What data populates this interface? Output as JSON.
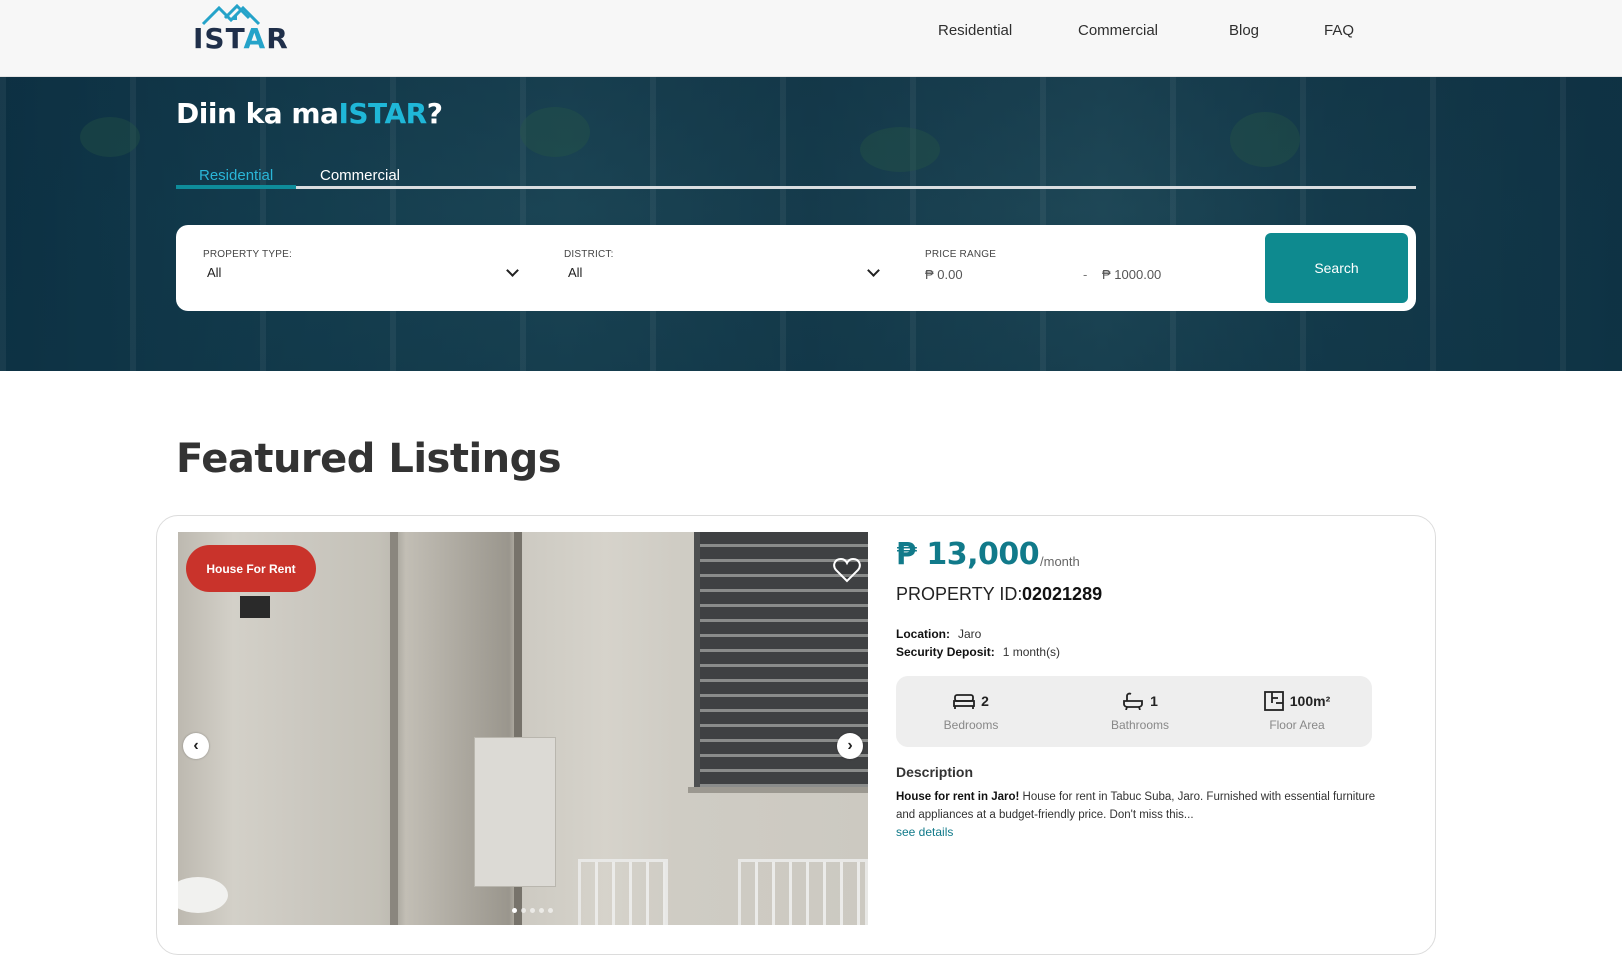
{
  "nav": {
    "logo_text_pre": "IST",
    "logo_text_a": "A",
    "logo_text_post": "R",
    "links": [
      {
        "label": "Residential"
      },
      {
        "label": "Commercial"
      },
      {
        "label": "Blog"
      },
      {
        "label": "FAQ"
      }
    ]
  },
  "hero": {
    "title_pre": "Diin ka ma",
    "title_accent": "ISTAR",
    "title_post": "?",
    "tabs": [
      {
        "label": "Residential",
        "active": true
      },
      {
        "label": "Commercial",
        "active": false
      }
    ],
    "search": {
      "property_type_label": "PROPERTY TYPE:",
      "property_type_value": "All",
      "district_label": "DISTRICT:",
      "district_value": "All",
      "price_range_label": "PRICE RANGE",
      "price_min": "₱ 0.00",
      "price_separator": "-",
      "price_max": "₱ 1000.00",
      "button_label": "Search"
    }
  },
  "featured": {
    "title": "Featured Listings",
    "listing": {
      "badge": "House For Rent",
      "price": "₱ 13,000",
      "price_unit": "/month",
      "property_id_label": "PROPERTY ID:",
      "property_id": "02021289",
      "location_label": "Location:",
      "location": "Jaro",
      "deposit_label": "Security Deposit:",
      "deposit": "1 month(s)",
      "features": [
        {
          "value": "2",
          "label": "Bedrooms",
          "icon": "bed-icon"
        },
        {
          "value": "1",
          "label": "Bathrooms",
          "icon": "bathtub-icon"
        },
        {
          "value": "100m²",
          "label": "Floor Area",
          "icon": "floor-plan-icon"
        }
      ],
      "description_title": "Description",
      "description_bold": "House for rent in Jaro!",
      "description_text": " House for rent in Tabuc Suba, Jaro. Furnished with essential furniture and appliances at a budget-friendly price. Don't miss this...",
      "see_details": "see details",
      "carousel_prev": "‹",
      "carousel_next": "›",
      "carousel_dots": 5,
      "carousel_active_dot": 0
    }
  },
  "colors": {
    "accent_teal": "#0e8a8f",
    "accent_cyan": "#1fb7d8",
    "badge_red": "#c9332b",
    "price_teal": "#117a8a"
  }
}
